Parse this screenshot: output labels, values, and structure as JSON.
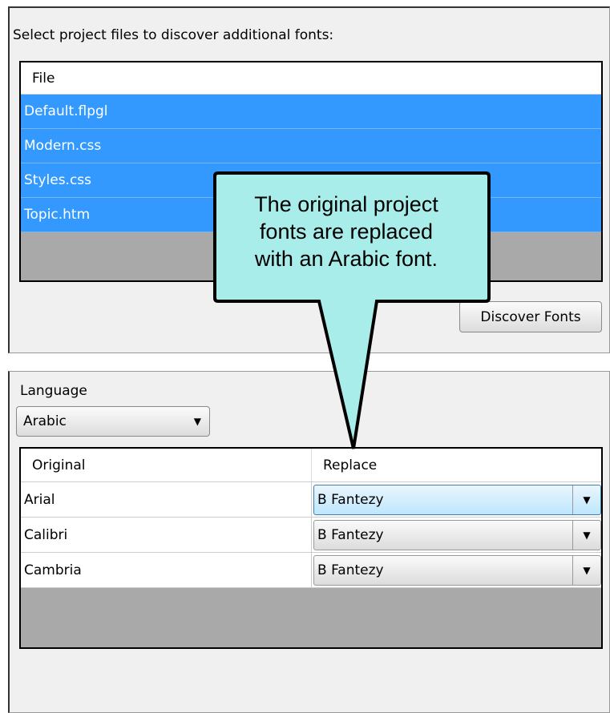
{
  "discover": {
    "instruction": "Select project files to discover additional fonts:",
    "column_header": "File",
    "files": [
      "Default.flpgl",
      "Modern.css",
      "Styles.css",
      "Topic.htm"
    ],
    "discover_button": "Discover Fonts"
  },
  "language": {
    "label": "Language",
    "selected": "Arabic"
  },
  "fonts_table": {
    "headers": {
      "original": "Original",
      "replace": "Replace"
    },
    "rows": [
      {
        "original": "Arial",
        "replace": "B Fantezy"
      },
      {
        "original": "Calibri",
        "replace": "B Fantezy"
      },
      {
        "original": "Cambria",
        "replace": "B Fantezy"
      }
    ]
  },
  "callout": {
    "lines": [
      "The original project",
      "fonts are replaced",
      "with an Arabic font."
    ],
    "fill_color": "#a8ede9"
  },
  "colors": {
    "selection": "#3399ff",
    "empty_area": "#a9a9a9"
  }
}
